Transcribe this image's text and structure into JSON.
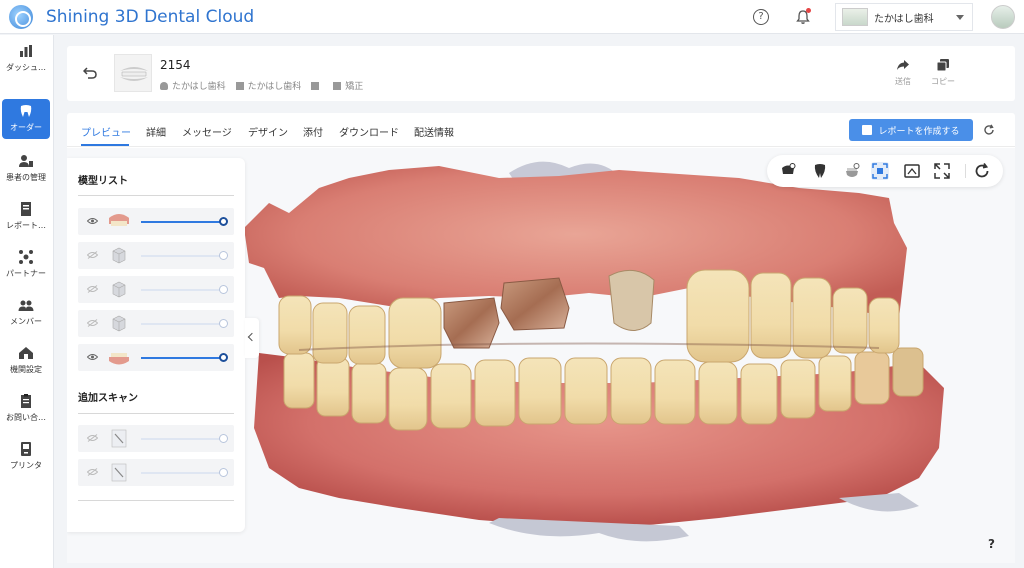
{
  "app": {
    "title": "Shining 3D Dental Cloud"
  },
  "header": {
    "clinic_name": "たかはし歯科",
    "notification_dot_color": "#e54545",
    "help_icon": "help-circle-icon",
    "bell_icon": "bell-icon"
  },
  "sidebar": {
    "items": [
      {
        "label": "ダッシュ…",
        "icon": "bar-chart-icon",
        "active": false
      },
      {
        "label": "オーダー",
        "icon": "tooth-icon",
        "active": true
      },
      {
        "label": "患者の管理",
        "icon": "patient-icon",
        "active": false
      },
      {
        "label": "レポート…",
        "icon": "report-icon",
        "active": false
      },
      {
        "label": "パートナー",
        "icon": "partner-icon",
        "active": false
      },
      {
        "label": "メンバー",
        "icon": "members-icon",
        "active": false
      },
      {
        "label": "機関設定",
        "icon": "building-settings-icon",
        "active": false
      },
      {
        "label": "お問い合…",
        "icon": "clipboard-icon",
        "active": false
      },
      {
        "label": "プリンタ",
        "icon": "printer-icon",
        "active": false
      }
    ]
  },
  "order": {
    "number": "2154",
    "meta": [
      {
        "icon": "person-icon",
        "text": "たかはし歯科"
      },
      {
        "icon": "building-icon",
        "text": "たかはし歯科"
      },
      {
        "icon": "building-icon",
        "text": ""
      },
      {
        "icon": "tooth-small-icon",
        "text": "矯正"
      }
    ],
    "actions": [
      {
        "label": "送信",
        "icon": "share-icon"
      },
      {
        "label": "コピー",
        "icon": "copy-icon"
      }
    ]
  },
  "tabs": [
    {
      "label": "プレビュー",
      "active": true
    },
    {
      "label": "詳細",
      "active": false
    },
    {
      "label": "メッセージ",
      "active": false
    },
    {
      "label": "デザイン",
      "active": false
    },
    {
      "label": "添付",
      "active": false
    },
    {
      "label": "ダウンロード",
      "active": false
    },
    {
      "label": "配送情報",
      "active": false
    }
  ],
  "report_button": {
    "label": "レポートを作成する"
  },
  "model_panel": {
    "title": "模型リスト",
    "models": [
      {
        "visible": true,
        "thumb": "upper-jaw-scan-thumb",
        "opacity": 1.0
      },
      {
        "visible": false,
        "thumb": "model-cube-thumb",
        "opacity": 1.0
      },
      {
        "visible": false,
        "thumb": "model-cube-thumb",
        "opacity": 1.0
      },
      {
        "visible": false,
        "thumb": "model-cube-thumb",
        "opacity": 1.0
      },
      {
        "visible": true,
        "thumb": "lower-jaw-scan-thumb",
        "opacity": 1.0
      }
    ],
    "extra_title": "追加スキャン",
    "extra_scans": [
      {
        "visible": false,
        "thumb": "scan-file-thumb",
        "opacity": 1.0
      },
      {
        "visible": false,
        "thumb": "scan-file-thumb",
        "opacity": 1.0
      }
    ]
  },
  "toolbar3d": {
    "tools": [
      {
        "icon": "upper-jaw-toggle-icon",
        "selected": false
      },
      {
        "icon": "tooth-view-icon",
        "selected": false
      },
      {
        "icon": "lower-jaw-toggle-icon",
        "selected": false
      },
      {
        "icon": "fit-view-icon",
        "selected": true
      },
      {
        "icon": "occlusion-map-icon",
        "selected": false
      },
      {
        "icon": "fullscreen-icon",
        "selected": false
      },
      {
        "icon": "reset-rotate-icon",
        "selected": false
      }
    ]
  },
  "viewport": {
    "help": "?"
  },
  "colors": {
    "accent": "#2f79e0",
    "title": "#2f74cf",
    "report_button": "#4a8fe8"
  }
}
